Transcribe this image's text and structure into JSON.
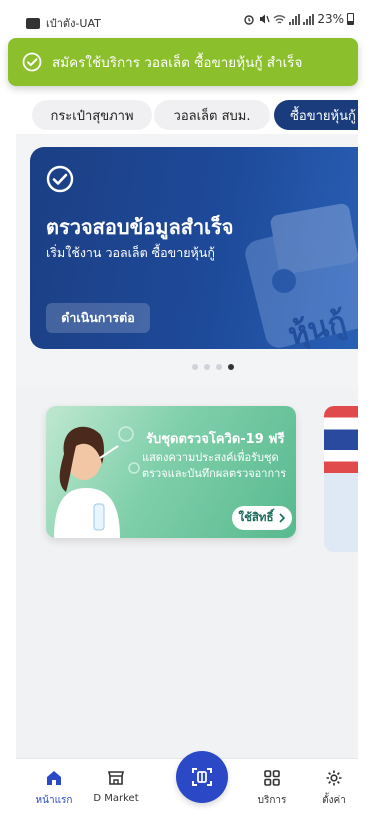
{
  "status_bar": {
    "app_name": "เป๋าตัง-UAT",
    "battery": "23%"
  },
  "toast": {
    "message": "สมัครใช้บริการ วอลเล็ต ซื้อขายหุ้นกู้ สำเร็จ"
  },
  "categories": {
    "items": [
      {
        "label": "กระเป๋าสุขภาพ",
        "active": false
      },
      {
        "label": "วอลเล็ต สบม.",
        "active": false
      },
      {
        "label": "ซื้อขายหุ้นกู้",
        "active": true
      }
    ]
  },
  "banner": {
    "title": "ตรวจสอบข้อมูลสำเร็จ",
    "subtitle": "เริ่มใช้งาน วอลเล็ต ซื้อขายหุ้นกู้",
    "button_label": "ดำเนินการต่อ",
    "art_text": "หุ้นกู้"
  },
  "pager": {
    "total": 4,
    "active_index": 3
  },
  "promo": {
    "title": "รับชุดตรวจโควิด-19 ฟรี",
    "description": "แสดงความประสงค์เพื่อรับชุดตรวจและบันทึกผลตรวจอาการ",
    "button_label": "ใช้สิทธิ์"
  },
  "bottom_nav": {
    "items": [
      {
        "label": "หน้าแรก",
        "icon": "home-icon",
        "active": true
      },
      {
        "label": "D Market",
        "icon": "store-icon",
        "active": false
      },
      {
        "label": "",
        "icon": "scan-icon",
        "active": false
      },
      {
        "label": "บริการ",
        "icon": "grid-icon",
        "active": false
      },
      {
        "label": "ตั้งค่า",
        "icon": "gear-icon",
        "active": false
      }
    ]
  },
  "colors": {
    "toast_bg": "#8bbf2c",
    "banner_bg": "#1e4a9a",
    "accent": "#2b49c6",
    "active_tab": "#1a3c7d"
  }
}
